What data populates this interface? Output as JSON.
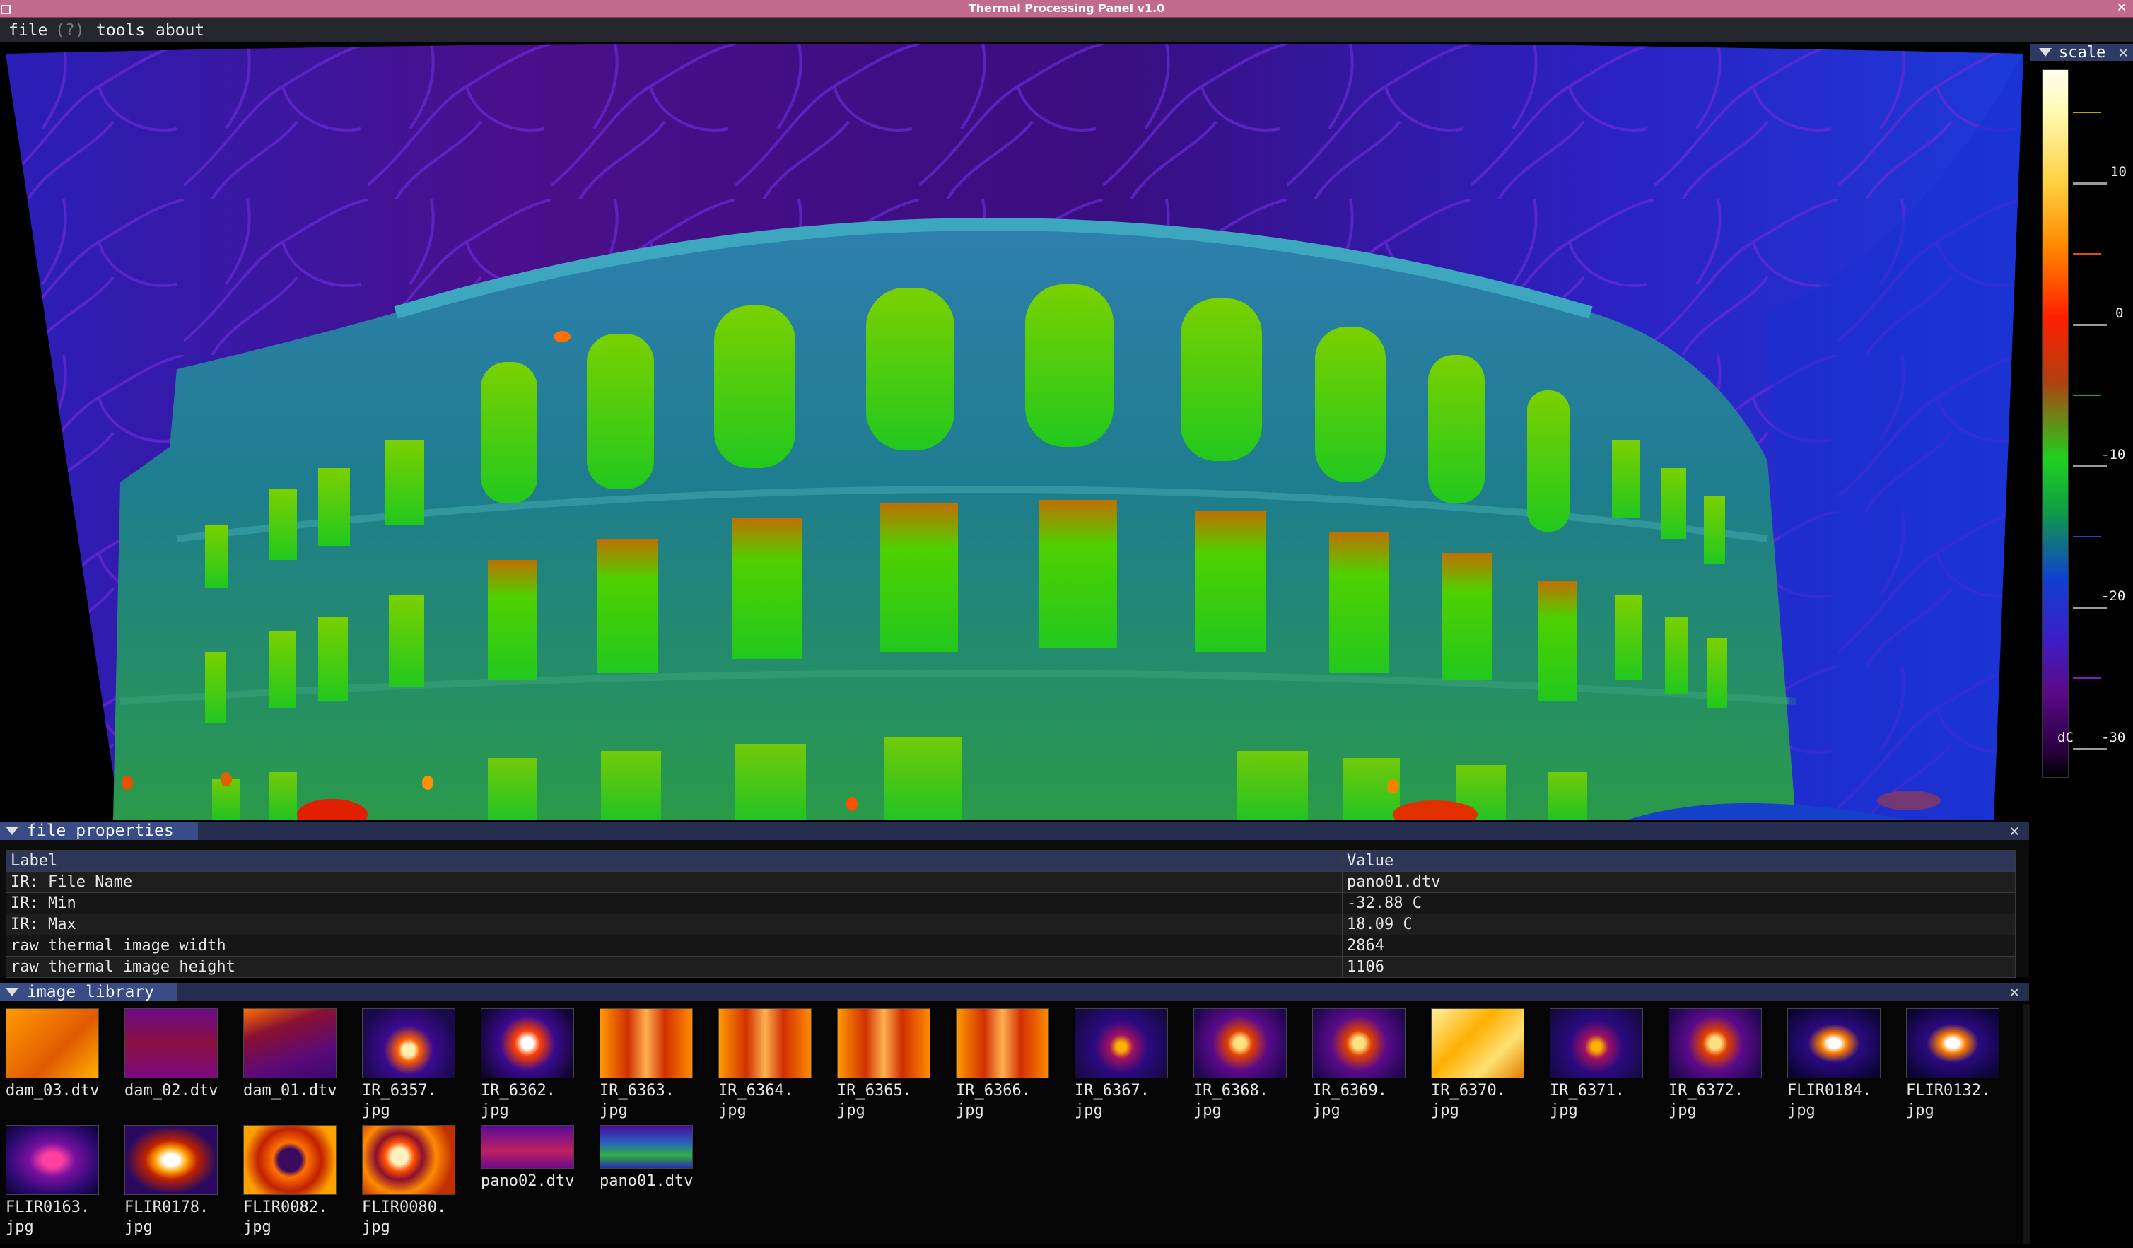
{
  "window": {
    "title": "Thermal Processing Panel v1.0"
  },
  "menu": {
    "file": "file",
    "help": "(?)",
    "tools": "tools",
    "about": "about"
  },
  "scale_panel": {
    "title": "scale",
    "unit": "dC",
    "ticks": [
      "10",
      "0",
      "-10",
      "-20",
      "-30"
    ]
  },
  "file_properties": {
    "title": "file properties",
    "columns": [
      "Label",
      "Value"
    ],
    "rows": [
      {
        "label": "IR: File Name",
        "value": "pano01.dtv"
      },
      {
        "label": "IR: Min",
        "value": "-32.88 C"
      },
      {
        "label": "IR: Max",
        "value": "18.09 C"
      },
      {
        "label": "raw thermal image width",
        "value": "2864"
      },
      {
        "label": "raw thermal image height",
        "value": "1106"
      }
    ]
  },
  "image_library": {
    "title": "image library",
    "items": [
      {
        "label": "dam_03.dtv",
        "style": "orange-flat"
      },
      {
        "label": "dam_02.dtv",
        "style": "purple-red"
      },
      {
        "label": "dam_01.dtv",
        "style": "purple-red-dark"
      },
      {
        "label": "IR_6357.\njpg",
        "style": "dark-hot"
      },
      {
        "label": "IR_6362.\njpg",
        "style": "dark-hot2"
      },
      {
        "label": "IR_6363.\njpg",
        "style": "pipe"
      },
      {
        "label": "IR_6364.\njpg",
        "style": "pipe"
      },
      {
        "label": "IR_6365.\njpg",
        "style": "pipe"
      },
      {
        "label": "IR_6366.\njpg",
        "style": "pipe"
      },
      {
        "label": "IR_6367.\njpg",
        "style": "cat-dark"
      },
      {
        "label": "IR_6368.\njpg",
        "style": "cat"
      },
      {
        "label": "IR_6369.\njpg",
        "style": "cat"
      },
      {
        "label": "IR_6370.\njpg",
        "style": "yellow"
      },
      {
        "label": "IR_6371.\njpg",
        "style": "cat-dark"
      },
      {
        "label": "IR_6372.\njpg",
        "style": "cat"
      },
      {
        "label": "FLIR0184.\njpg",
        "style": "bottle"
      },
      {
        "label": "FLIR0132.\njpg",
        "style": "bottle"
      },
      {
        "label": "FLIR0163.\njpg",
        "style": "glass"
      },
      {
        "label": "FLIR0178.\njpg",
        "style": "cup"
      },
      {
        "label": "FLIR0082.\njpg",
        "style": "leaf"
      },
      {
        "label": "FLIR0080.\njpg",
        "style": "rings"
      },
      {
        "label": "pano02.dtv",
        "style": "pano2"
      },
      {
        "label": "pano01.dtv",
        "style": "pano1"
      }
    ]
  },
  "colors": {
    "title_bar": "#c26a8e",
    "menu_bar": "#26262e",
    "panel_header": "#262e4f",
    "panel_tab": "#3a4c85"
  }
}
